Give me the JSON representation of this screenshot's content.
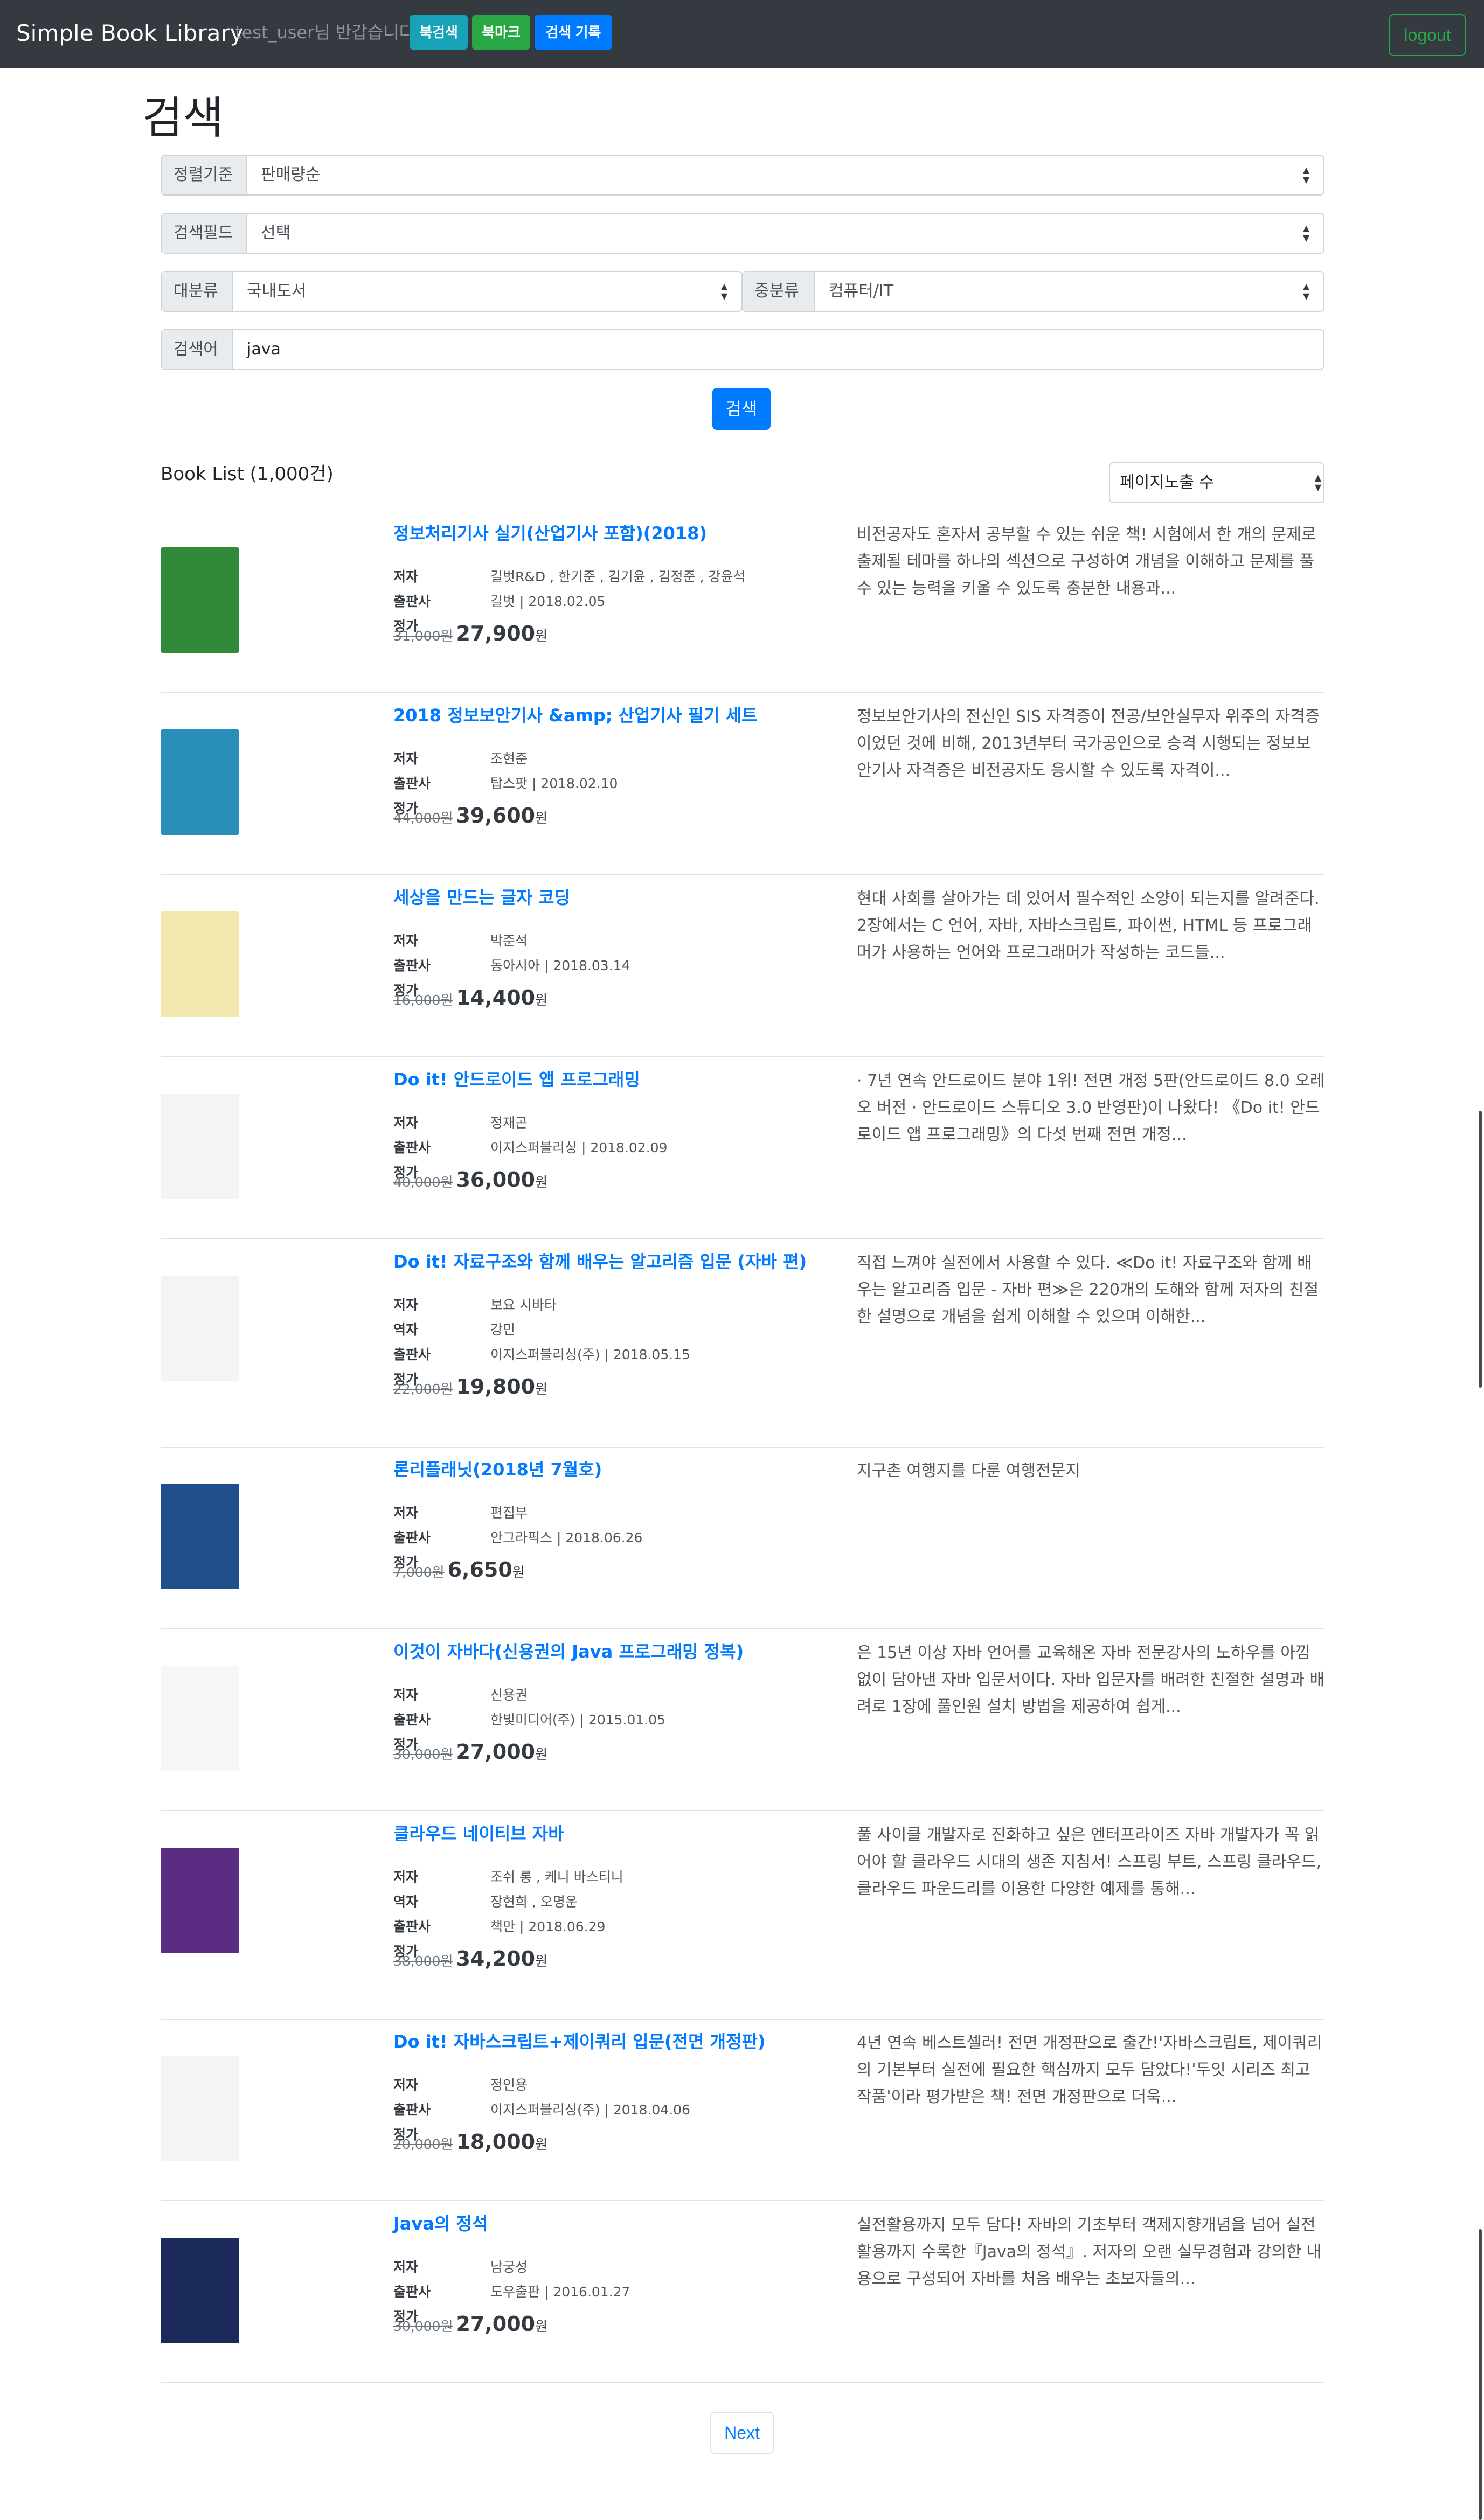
{
  "nav": {
    "brand": "Simple Book Library",
    "welcome": "test_user님 반갑습니다.",
    "btn_recommend": "북검색",
    "btn_bookmark": "북마크",
    "btn_history": "검색 기록",
    "logout": "logout"
  },
  "page_title": "검색",
  "form": {
    "sort_label": "정렬기준",
    "sort_value": "판매량순",
    "field_label": "검색필드",
    "field_value": "선택",
    "major_label": "대분류",
    "major_value": "국내도서",
    "minor_label": "중분류",
    "minor_value": "컴퓨터/IT",
    "query_label": "검색어",
    "query_value": "java",
    "search_button": "검색"
  },
  "list": {
    "title": "Book List (1,000건)",
    "per_page": "페이지노출 수"
  },
  "labels": {
    "author": "저자",
    "translator": "역자",
    "publisher": "출판사",
    "price": "정가",
    "won": "원"
  },
  "books": [
    {
      "title": "정보처리기사 실기(산업기사 포함)(2018)",
      "author": "길벗R&D , 한기준 , 김기윤 , 김정준 , 강윤석",
      "translator": "",
      "publisher": "길벗 | 2018.02.05",
      "orig_price": "31,000원",
      "sale_price": "27,900",
      "desc": "비전공자도 혼자서 공부할 수 있는 쉬운 책! 시험에서 한 개의 문제로 출제될 테마를 하나의 섹션으로 구성하여 개념을 이해하고 문제를 풀 수 있는 능력을 키울 수 있도록 충분한 내용과...",
      "cover_color": "#2f8a3a"
    },
    {
      "title": "2018 정보보안기사 &amp; 산업기사 필기 세트",
      "author": "조현준",
      "translator": "",
      "publisher": "탑스팟 | 2018.02.10",
      "orig_price": "44,000원",
      "sale_price": "39,600",
      "desc": "정보보안기사의 전신인 SIS 자격증이 전공/보안실무자 위주의 자격증이었던 것에 비해, 2013년부터 국가공인으로 승격 시행되는 정보보안기사 자격증은 비전공자도 응시할 수 있도록 자격이...",
      "cover_color": "#2a8fb8"
    },
    {
      "title": "세상을 만드는 글자 코딩",
      "author": "박준석",
      "translator": "",
      "publisher": "동아시아 | 2018.03.14",
      "orig_price": "16,000원",
      "sale_price": "14,400",
      "desc": "현대 사회를 살아가는 데 있어서 필수적인 소양이 되는지를 알려준다. 2장에서는 C 언어, 자바, 자바스크립트, 파이썬, HTML 등 프로그래머가 사용하는 언어와 프로그래머가 작성하는 코드들...",
      "cover_color": "#f3e9b0"
    },
    {
      "title": "Do it! 안드로이드 앱 프로그래밍",
      "author": "정재곤",
      "translator": "",
      "publisher": "이지스퍼블리싱 | 2018.02.09",
      "orig_price": "40,000원",
      "sale_price": "36,000",
      "desc": "· 7년 연속 안드로이드 분야 1위! 전면 개정 5판(안드로이드 8.0 오레오 버전 · 안드로이드 스튜디오 3.0 반영판)이 나왔다! 《Do it! 안드로이드 앱 프로그래밍》의 다섯 번째 전면 개정...",
      "cover_color": "#f4f4f4"
    },
    {
      "title": "Do it! 자료구조와 함께 배우는 알고리즘 입문 (자바 편)",
      "author": "보요 시바타",
      "translator": "강민",
      "publisher": "이지스퍼블리싱(주) | 2018.05.15",
      "orig_price": "22,000원",
      "sale_price": "19,800",
      "desc": "직접 느껴야 실전에서 사용할 수 있다. ≪Do it! 자료구조와 함께 배우는 알고리즘 입문 - 자바 편≫은 220개의 도해와 함께 저자의 친절한 설명으로 개념을 쉽게 이해할 수 있으며 이해한...",
      "cover_color": "#f4f4f4"
    },
    {
      "title": "론리플래닛(2018년 7월호)",
      "author": "편집부",
      "translator": "",
      "publisher": "안그라픽스 | 2018.06.26",
      "orig_price": "7,000원",
      "sale_price": "6,650",
      "desc": "지구촌 여행지를 다룬 여행전문지",
      "cover_color": "#1f4e8c"
    },
    {
      "title": "이것이 자바다(신용권의 Java 프로그래밍 정복)",
      "author": "신용권",
      "translator": "",
      "publisher": "한빛미디어(주) | 2015.01.05",
      "orig_price": "30,000원",
      "sale_price": "27,000",
      "desc": "은 15년 이상 자바 언어를 교육해온 자바 전문강사의 노하우를 아낌 없이 담아낸 자바 입문서이다. 자바 입문자를 배려한 친절한 설명과 배려로 1장에 풀인원 설치 방법을 제공하여 쉽게...",
      "cover_color": "#f7f7f7"
    },
    {
      "title": "클라우드 네이티브 자바",
      "author": "조쉬 롱 , 케니 바스티니",
      "translator": "장현희 , 오명운",
      "publisher": "책만 | 2018.06.29",
      "orig_price": "38,000원",
      "sale_price": "34,200",
      "desc": "풀 사이클 개발자로 진화하고 싶은 엔터프라이즈 자바 개발자가 꼭 읽어야 할 클라우드 시대의 생존 지침서! 스프링 부트, 스프링 클라우드, 클라우드 파운드리를 이용한 다양한 예제를 통해...",
      "cover_color": "#5b2d82"
    },
    {
      "title": "Do it! 자바스크립트+제이쿼리 입문(전면 개정판)",
      "author": "정인용",
      "translator": "",
      "publisher": "이지스퍼블리싱(주) | 2018.04.06",
      "orig_price": "20,000원",
      "sale_price": "18,000",
      "desc": "4년 연속 베스트셀러! 전면 개정판으로 출간!'자바스크립트, 제이쿼리의 기본부터 실전에 필요한 핵심까지 모두 담았다!'두잇 시리즈 최고 작품'이라 평가받은 책! 전면 개정판으로 더욱...",
      "cover_color": "#f4f4f4"
    },
    {
      "title": "Java의 정석",
      "author": "남궁성",
      "translator": "",
      "publisher": "도우출판 | 2016.01.27",
      "orig_price": "30,000원",
      "sale_price": "27,000",
      "desc": "실전활용까지 모두 담다! 자바의 기초부터 객제지향개념을 넘어 실전활용까지 수록한『Java의 정석』. 저자의 오랜 실무경험과 강의한 내용으로 구성되어 자바를 처음 배우는 초보자들의...",
      "cover_color": "#1b2a5a"
    }
  ],
  "pagination": {
    "next": "Next"
  }
}
